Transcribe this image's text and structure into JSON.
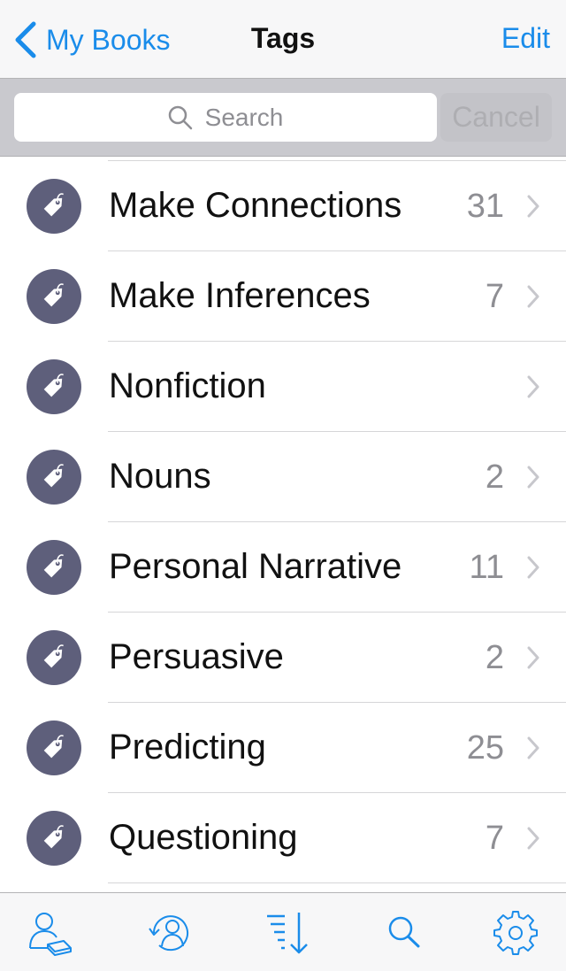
{
  "nav": {
    "back_label": "My Books",
    "title": "Tags",
    "edit_label": "Edit"
  },
  "search": {
    "placeholder": "Search",
    "cancel_label": "Cancel"
  },
  "tags": [
    {
      "name": "Make Connections",
      "count": "31"
    },
    {
      "name": "Make Inferences",
      "count": "7"
    },
    {
      "name": "Nonfiction",
      "count": ""
    },
    {
      "name": "Nouns",
      "count": "2"
    },
    {
      "name": "Personal Narrative",
      "count": "11"
    },
    {
      "name": "Persuasive",
      "count": "2"
    },
    {
      "name": "Predicting",
      "count": "25"
    },
    {
      "name": "Questioning",
      "count": "7"
    }
  ],
  "tabbar": {
    "items": [
      "users-book-icon",
      "user-refresh-icon",
      "sort-icon",
      "search-icon",
      "gear-icon"
    ]
  },
  "colors": {
    "accent": "#1a8cea",
    "tag_icon_bg": "#5e5f7b",
    "count_text": "#8e8e93"
  }
}
